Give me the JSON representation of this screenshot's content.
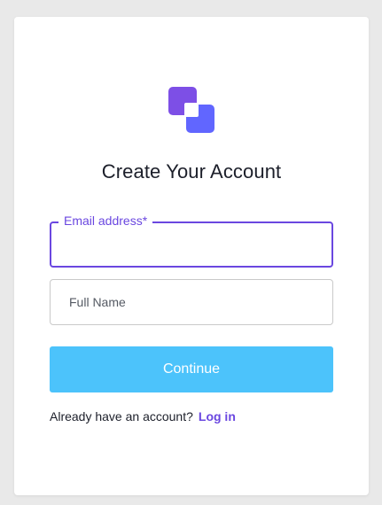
{
  "signup": {
    "logo_icon": "overlapping-squares-logo-icon",
    "title": "Create Your Account",
    "email": {
      "label": "Email address*",
      "value": ""
    },
    "full_name": {
      "placeholder": "Full Name",
      "value": ""
    },
    "continue_label": "Continue",
    "footer_text": "Already have an account?",
    "login_link": "Log in"
  },
  "colors": {
    "brand_purple": "#6a47e0",
    "logo_front": "#6166ff",
    "logo_back": "#7d4fe6",
    "continue_button": "#4cc3fb",
    "page_background": "#e9e9e9"
  }
}
